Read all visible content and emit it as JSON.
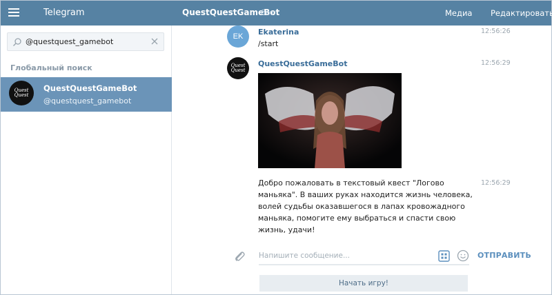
{
  "header": {
    "app_title": "Telegram",
    "chat_title": "QuestQuestGameBot",
    "chat_subtitle": "бот",
    "media_label": "Медиа",
    "edit_label": "Редактировать"
  },
  "sidebar": {
    "search_value": "@questquest_gamebot",
    "section_label": "Глобальный поиск",
    "results": [
      {
        "name": "QuestQuestGameBot",
        "username": "@questquest_gamebot",
        "avatar_text_1": "Quest",
        "avatar_text_2": "Quest"
      }
    ]
  },
  "messages": [
    {
      "author": "Ekaterina",
      "avatar_initials": "EK",
      "text": "/start",
      "time": "12:56:26"
    },
    {
      "author": "QuestQuestGameBot",
      "avatar_text_1": "Quest",
      "avatar_text_2": "Quest",
      "time": "12:56:29",
      "has_photo": true
    },
    {
      "text": "Добро пожаловать в текстовый квест \"Логово маньяка\". В ваших руках находится жизнь человека, волей судьбы оказавшегося в лапах кровожадного маньяка, помогите ему выбраться и спасти свою жизнь, удачи!",
      "time": "12:56:29"
    }
  ],
  "composer": {
    "placeholder": "Напишите сообщение...",
    "send_label": "ОТПРАВИТЬ",
    "start_button_label": "Начать игру!"
  },
  "colors": {
    "header_bg": "#5682a3",
    "selected_bg": "#6b94b8",
    "author": "#3a6d99",
    "send": "#5b8fbd"
  },
  "icons": [
    "menu-icon",
    "search-icon",
    "clear-icon",
    "attach-icon",
    "keyboard-icon",
    "emoji-icon"
  ]
}
